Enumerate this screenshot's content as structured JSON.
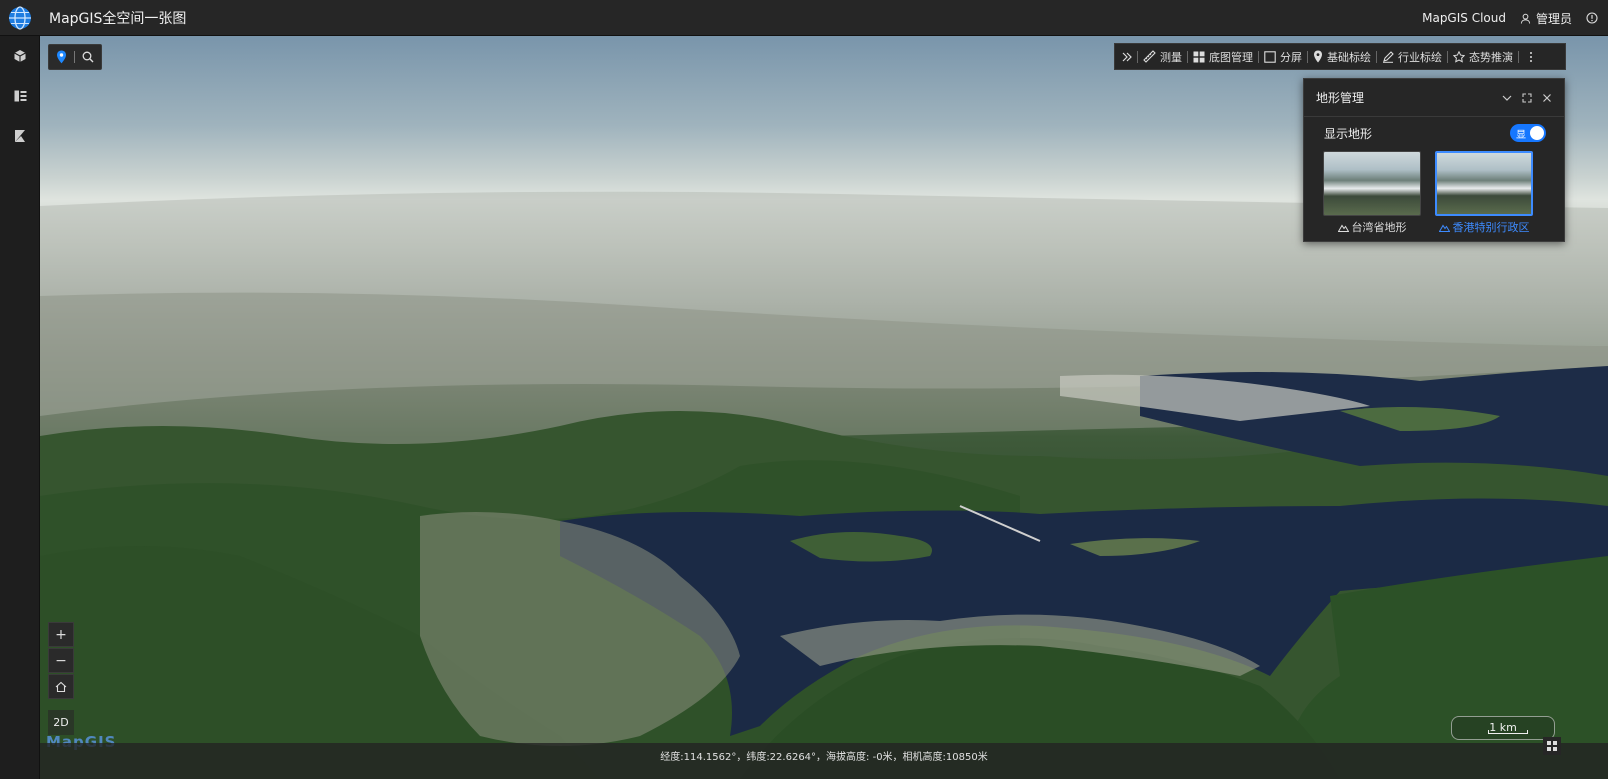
{
  "header": {
    "app_title": "MapGIS全空间一张图",
    "cloud_label": "MapGIS Cloud",
    "user_label": "管理员"
  },
  "sidebar": {
    "items": [
      {
        "icon": "cube-icon"
      },
      {
        "icon": "layers-list-icon"
      },
      {
        "icon": "kibana-icon"
      }
    ]
  },
  "toolbar": {
    "items": [
      {
        "label": "测量",
        "icon": "measure-icon"
      },
      {
        "label": "底图管理",
        "icon": "grid-icon"
      },
      {
        "label": "分屏",
        "icon": "split-screen-icon"
      },
      {
        "label": "基础标绘",
        "icon": "pin-icon"
      },
      {
        "label": "行业标绘",
        "icon": "pen-icon"
      },
      {
        "label": "态势推演",
        "icon": "star-icon"
      }
    ]
  },
  "terrain_panel": {
    "title": "地形管理",
    "show_terrain_label": "显示地形",
    "toggle_text": "显",
    "toggle_on": true,
    "items": [
      {
        "label": "台湾省地形",
        "active": false
      },
      {
        "label": "香港特别行政区",
        "active": true
      }
    ]
  },
  "map_controls": {
    "zoom_in": "+",
    "zoom_out": "−",
    "mode_2d": "2D",
    "brand_mark": "MapGIS"
  },
  "scale": {
    "label": "1 km"
  },
  "status": {
    "text": "经度:114.1562°，纬度:22.6264°，海拔高度: -0米，相机高度:10850米"
  },
  "colors": {
    "accent": "#1677ff",
    "panel": "#262626",
    "water": "#1b2a45"
  }
}
